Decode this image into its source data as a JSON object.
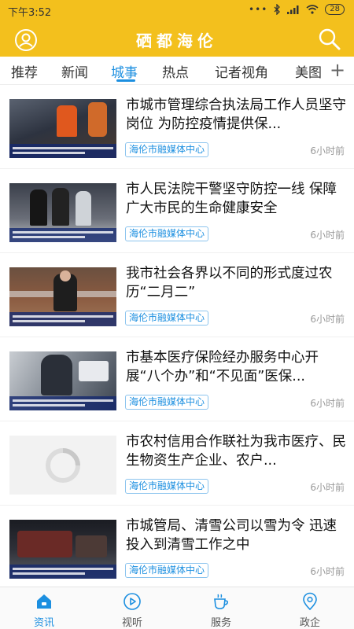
{
  "status": {
    "time": "下午3:52",
    "battery": "28"
  },
  "header": {
    "title": "硒都海伦"
  },
  "tabs": [
    {
      "label": "推荐"
    },
    {
      "label": "新闻"
    },
    {
      "label": "城事"
    },
    {
      "label": "热点"
    },
    {
      "label": "记者视角"
    },
    {
      "label": "美图"
    }
  ],
  "active_tab": "城事",
  "articles": [
    {
      "title": "市城市管理综合执法局工作人员坚守岗位 为防控疫情提供保...",
      "source": "海伦市融媒体中心",
      "time": "6小时前"
    },
    {
      "title": "市人民法院干警坚守防控一线 保障广大市民的生命健康安全",
      "source": "海伦市融媒体中心",
      "time": "6小时前"
    },
    {
      "title": "我市社会各界以不同的形式度过农历“二月二”",
      "source": "海伦市融媒体中心",
      "time": "6小时前"
    },
    {
      "title": "市基本医疗保险经办服务中心开展“八个办”和“不见面”医保...",
      "source": "海伦市融媒体中心",
      "time": "6小时前"
    },
    {
      "title": "市农村信用合作联社为我市医疗、民生物资生产企业、农户...",
      "source": "海伦市融媒体中心",
      "time": "6小时前"
    },
    {
      "title": "市城管局、清雪公司以雪为令 迅速投入到清雪工作之中",
      "source": "海伦市融媒体中心",
      "time": "6小时前"
    }
  ],
  "bottom_nav": [
    {
      "label": "资讯",
      "icon": "home-icon"
    },
    {
      "label": "视听",
      "icon": "play-icon"
    },
    {
      "label": "服务",
      "icon": "cup-icon"
    },
    {
      "label": "政企",
      "icon": "location-icon"
    }
  ],
  "colors": {
    "header": "#f3c01d",
    "accent": "#1c8fe0"
  }
}
